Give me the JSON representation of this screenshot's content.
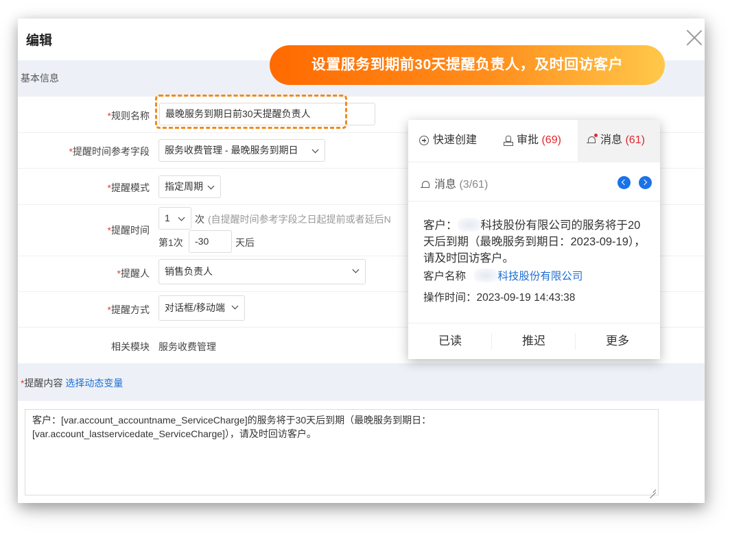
{
  "dialog": {
    "title": "编辑",
    "section_basic": "基本信息"
  },
  "banner": {
    "text": "设置服务到期前30天提醒负责人，及时回访客户"
  },
  "form": {
    "rule_name": {
      "label": "规则名称",
      "value": "最晚服务到期日前30天提醒负责人"
    },
    "ref_field": {
      "label": "提醒时间参考字段",
      "value": "服务收费管理 - 最晚服务到期日"
    },
    "mode": {
      "label": "提醒模式",
      "value": "指定周期"
    },
    "time": {
      "label": "提醒时间",
      "count_value": "1",
      "count_unit": "次",
      "hint": "(自提醒时间参考字段之日起提前或者延后N",
      "first_prefix": "第1次",
      "offset_value": "-30",
      "offset_unit": "天后"
    },
    "person": {
      "label": "提醒人",
      "value": "销售负责人"
    },
    "method": {
      "label": "提醒方式",
      "value": "对话框/移动端"
    },
    "module": {
      "label": "相关模块",
      "value": "服务收费管理"
    },
    "content": {
      "label": "提醒内容",
      "variable_link": "选择动态变量",
      "text_line1": "客户：[var.account_accountname_ServiceCharge]的服务将于30天后到期（最晚服务到期日：",
      "text_line2": "[var.account_lastservicedate_ServiceCharge]），请及时回访客户。"
    }
  },
  "popup": {
    "tabs": [
      {
        "label": "快速创建",
        "count": "",
        "icon": "plus-circle-icon"
      },
      {
        "label": "审批",
        "count": "(69)",
        "icon": "stamp-icon"
      },
      {
        "label": "消息",
        "count": "(61)",
        "icon": "bell-icon"
      }
    ],
    "header_label": "消息",
    "header_count": "(3/61)",
    "message_prefix": "客户：",
    "message_rest": "科技股份有限公司的服务将于20天后到期（最晚服务到期日：2023-09-19），请及时回访客户。",
    "customer_label": "客户名称",
    "customer_link": "科技股份有限公司",
    "op_time": "操作时间：2023-09-19 14:43:38",
    "actions": [
      "已读",
      "推迟",
      "更多"
    ]
  },
  "colors": {
    "accent": "#1f6fd1",
    "required": "#e53935",
    "count": "#e0262e",
    "banner_start": "#ff6a00",
    "banner_end": "#ffc84a",
    "section_band": "#edf1f7"
  }
}
